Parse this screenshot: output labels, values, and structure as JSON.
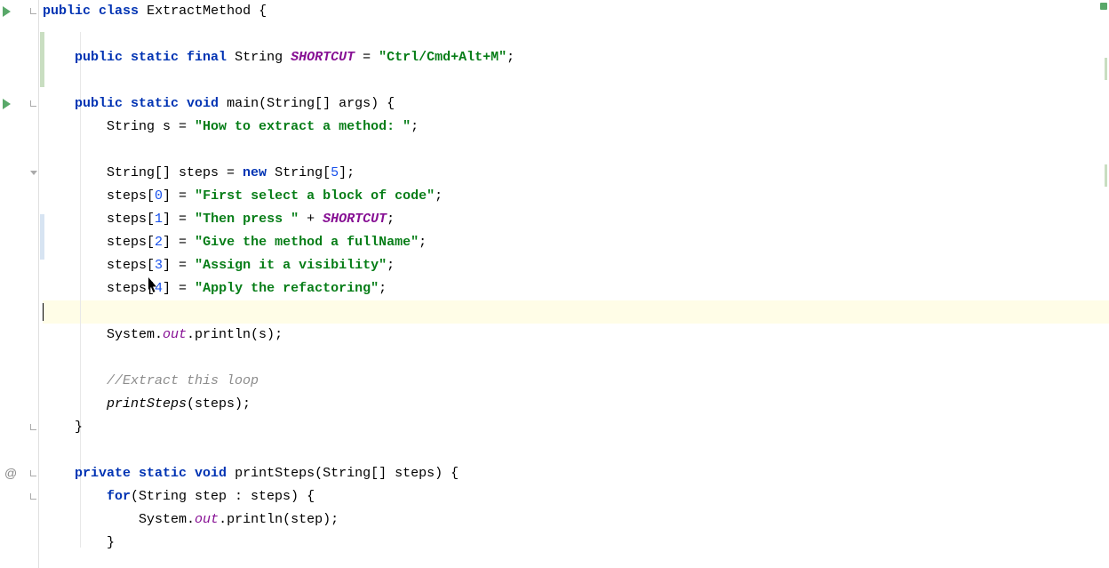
{
  "code": {
    "class_decl": {
      "public": "public",
      "class": "class",
      "name": "ExtractMethod",
      "brace": " {"
    },
    "field": {
      "mods": "public static final",
      "type": "String",
      "name": "SHORTCUT",
      "eq": " = ",
      "val": "\"Ctrl/Cmd+Alt+M\"",
      "semi": ";"
    },
    "main": {
      "mods": "public static void",
      "name": "main",
      "params": "(String[] args) {",
      "s_decl": {
        "pre": "String s = ",
        "val": "\"How to extract a method: \"",
        "semi": ";"
      },
      "arr_decl": {
        "pre": "String[] steps = ",
        "new": "new",
        "type": " String[",
        "num": "5",
        "post": "];"
      },
      "steps": [
        {
          "pre": "steps[",
          "idx": "0",
          "mid": "] = ",
          "val": "\"First select a block of code\"",
          "post": ";"
        },
        {
          "pre": "steps[",
          "idx": "1",
          "mid": "] = ",
          "val": "\"Then press \"",
          "plus": " + ",
          "ref": "SHORTCUT",
          "post": ";"
        },
        {
          "pre": "steps[",
          "idx": "2",
          "mid": "] = ",
          "val": "\"Give the method a fullName\"",
          "post": ";"
        },
        {
          "pre": "steps[",
          "idx": "3",
          "mid": "] = ",
          "val": "\"Assign it a visibility\"",
          "post": ";"
        },
        {
          "pre": "steps[",
          "idx": "4",
          "mid": "] = ",
          "val": "\"Apply the refactoring\"",
          "post": ";"
        }
      ],
      "println": {
        "pre": "System.",
        "out": "out",
        "mid": ".println(s);"
      },
      "comment": "//Extract this loop",
      "call": {
        "name": "printSteps",
        "args": "(steps);"
      },
      "close": "}"
    },
    "printSteps": {
      "mods": "private static void",
      "name": "printSteps",
      "params": "(String[] steps) {",
      "for": {
        "kw": "for",
        "rest": "(String step : steps) {"
      },
      "body": {
        "pre": "System.",
        "out": "out",
        "mid": ".println(step);"
      },
      "close_for": "}"
    }
  }
}
